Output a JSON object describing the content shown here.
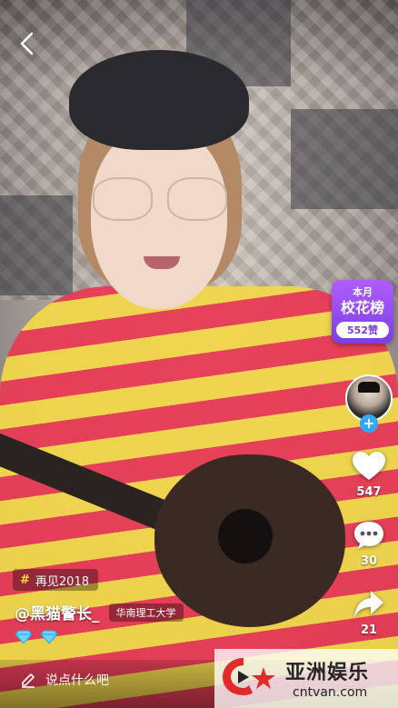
{
  "ui": {
    "back_icon": "chevron-left-icon",
    "badge": {
      "line1": "本月",
      "line2": "校花榜",
      "likes": "552赞"
    },
    "actions": {
      "like_count": "547",
      "comment_count": "30",
      "share_count": "21"
    },
    "hashtag": {
      "symbol": "#",
      "text": "再见2018"
    },
    "user": {
      "handle": "@黑猫警长_",
      "school": "华南理工大学"
    },
    "comment": {
      "placeholder": "说点什么吧"
    }
  },
  "watermark": {
    "title": "亚洲娱乐",
    "site": "cntvan.com"
  },
  "colors": {
    "badge_purple": "#8b46ea",
    "follow_blue": "#2fa9ff",
    "hashtag_yellow": "#ffd54a",
    "brand_red": "#e12b2b"
  }
}
